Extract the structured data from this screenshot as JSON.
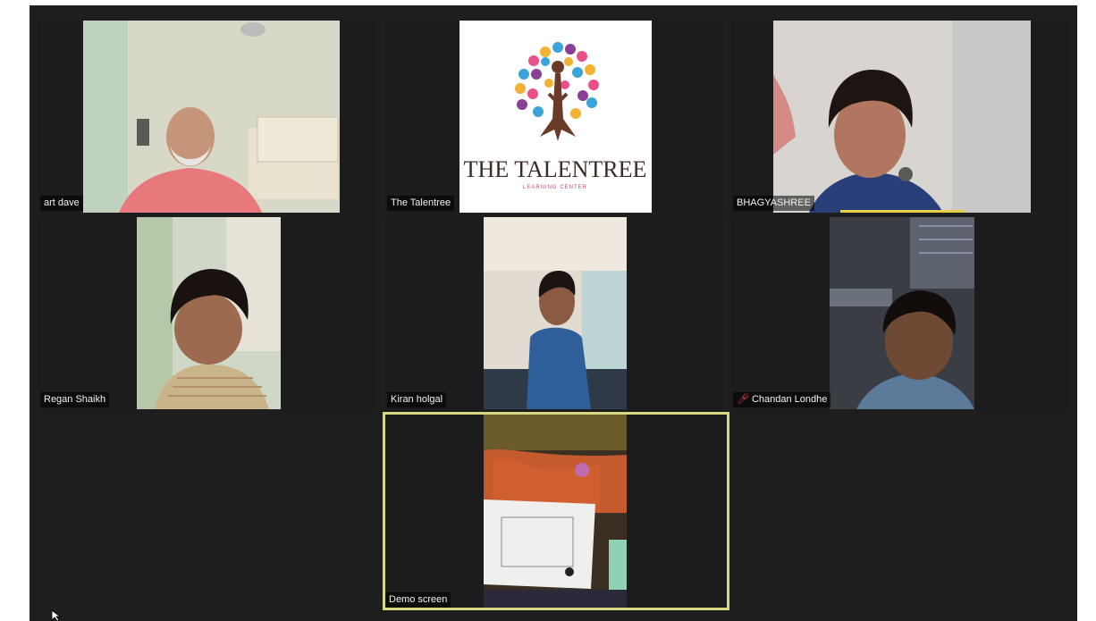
{
  "meeting": {
    "participants": [
      {
        "id": "art",
        "name": "art dave"
      },
      {
        "id": "talentree",
        "name": "The Talentree"
      },
      {
        "id": "bhagyashree",
        "name": "BHAGYASHREE"
      },
      {
        "id": "regan",
        "name": "Regan Shaikh"
      },
      {
        "id": "kiran",
        "name": "Kiran holgal"
      },
      {
        "id": "chandan",
        "name": "Chandan Londhe",
        "muted": true
      },
      {
        "id": "demo",
        "name": "Demo screen",
        "active_speaker": true
      }
    ],
    "logo": {
      "title": "THE TALENTREE",
      "subtitle": "LEARNING CENTER"
    }
  },
  "colors": {
    "active_border": "#d6d884",
    "speaking_indicator": "#e6cf4a",
    "muted_icon": "#e8433b",
    "background": "#1e1e1e"
  },
  "icons": {
    "muted": "mic-muted-icon",
    "cursor": "mouse-pointer-icon"
  }
}
